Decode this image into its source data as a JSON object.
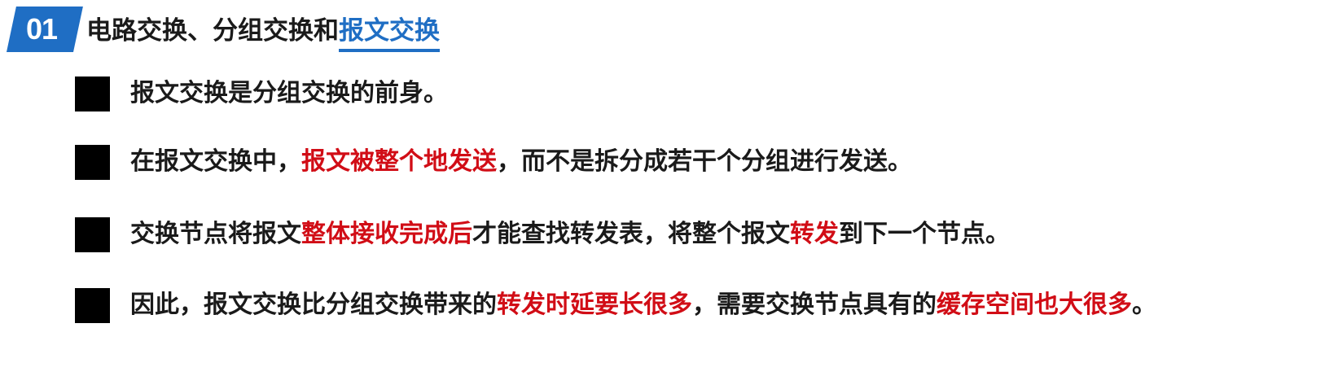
{
  "header": {
    "section_number": "01",
    "title_prefix": "电路交换、分组交换和",
    "title_highlight": "报文交换",
    "accent_color": "#1f6ec4"
  },
  "emphasis_color": "#d10d16",
  "bullets": [
    {
      "segments": [
        {
          "text": "报文交换是分组交换的前身。",
          "emphasis": false
        }
      ]
    },
    {
      "segments": [
        {
          "text": "在报文交换中，",
          "emphasis": false
        },
        {
          "text": "报文被整个地发送",
          "emphasis": true
        },
        {
          "text": "，而不是拆分成若干个分组进行发送。",
          "emphasis": false
        }
      ]
    },
    {
      "segments": [
        {
          "text": "交换节点将报文",
          "emphasis": false
        },
        {
          "text": "整体接收完成后",
          "emphasis": true
        },
        {
          "text": "才能查找转发表，将整个报文",
          "emphasis": false
        },
        {
          "text": "转发",
          "emphasis": true
        },
        {
          "text": "到下一个节点。",
          "emphasis": false
        }
      ]
    },
    {
      "segments": [
        {
          "text": "因此，报文交换比分组交换带来的",
          "emphasis": false
        },
        {
          "text": "转发时延要长很多",
          "emphasis": true
        },
        {
          "text": "，需要交换节点具有的",
          "emphasis": false
        },
        {
          "text": "缓存空间也大很多",
          "emphasis": true
        },
        {
          "text": "。",
          "emphasis": false
        }
      ]
    }
  ]
}
